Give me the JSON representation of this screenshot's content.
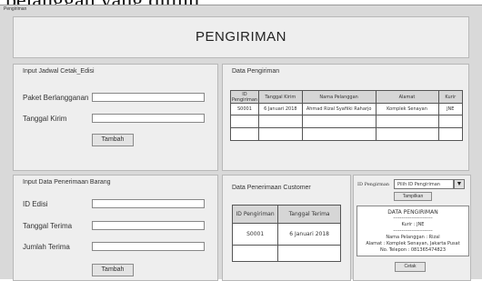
{
  "caption": "pelanggan yang dituju.",
  "window": {
    "title": "Pengiriman"
  },
  "header": {
    "title": "PENGIRIMAN"
  },
  "schedule_panel": {
    "title": "Input Jadwal Cetak_Edisi",
    "package_label": "Paket Berlangganan",
    "package_value": "",
    "date_label": "Tanggal Kirim",
    "date_value": "",
    "add_button": "Tambah"
  },
  "shipping_data": {
    "title": "Data Pengiriman",
    "columns": [
      "ID Pengiriman",
      "Tanggal Kirim",
      "Nama Pelanggan",
      "Alamat",
      "Kurir"
    ],
    "rows": [
      [
        "S0001",
        "6 Januari 2018",
        "Ahmad Rizal Syafiiki Raharjo",
        "Komplek Senayan",
        "JNE"
      ],
      [
        "",
        "",
        "",
        "",
        ""
      ],
      [
        "",
        "",
        "",
        "",
        ""
      ]
    ]
  },
  "receipt_panel": {
    "title": "Input Data Penerimaan Barang",
    "edition_label": "ID Edisi",
    "edition_value": "",
    "received_date_label": "Tanggal Terima",
    "received_date_value": "",
    "quantity_label": "Jumlah Terima",
    "quantity_value": "",
    "add_button": "Tambah"
  },
  "customer_receipt": {
    "title": "Data Penerimaan Customer",
    "columns": [
      "ID Pengiriman",
      "Tanggal Terima"
    ],
    "rows": [
      [
        "S0001",
        "6 Januari 2018"
      ],
      [
        "",
        ""
      ]
    ]
  },
  "print_panel": {
    "id_label": "ID Pengirman",
    "select_value": "Pilih ID Pengiriman",
    "show_button": "Tampilkan",
    "print_button": "Cetak",
    "slip": {
      "title": "DATA PENGIRIMAN",
      "separator": "------------------------",
      "courier": "Kurir : JNE",
      "separator2": "------------------------",
      "name": "Nama Pelanggan : Rizal",
      "address": "Alamat : Komplek Senayan, Jakarta Pusat",
      "phone": "No. Telepon : 081365474823"
    }
  }
}
